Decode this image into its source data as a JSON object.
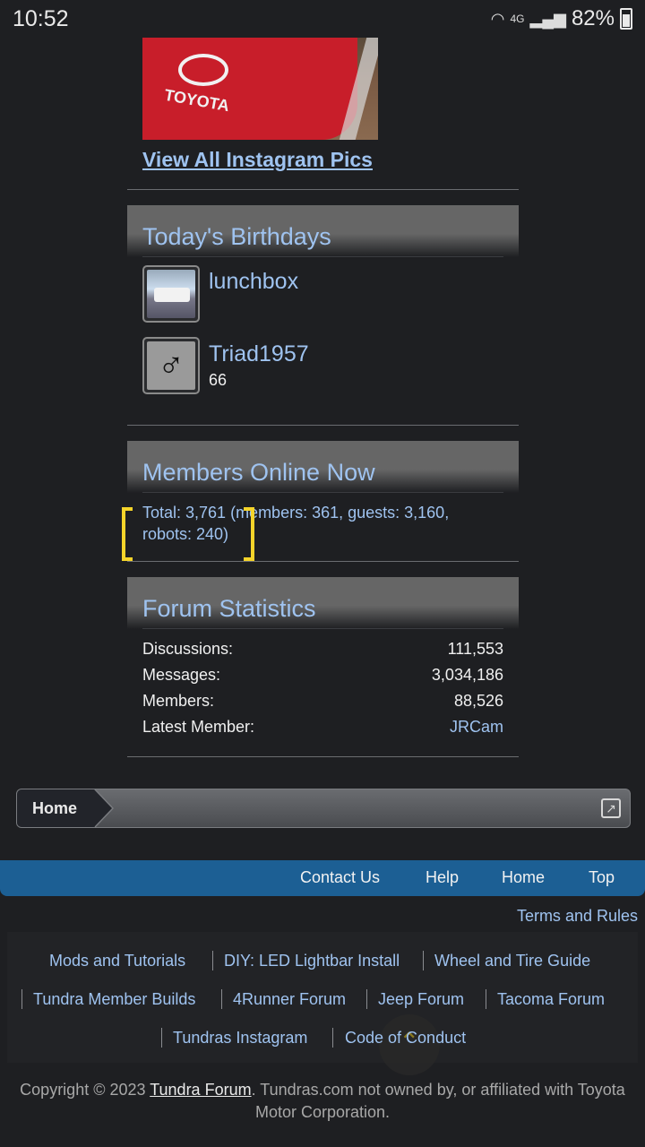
{
  "status_bar": {
    "time": "10:52",
    "network": "4G",
    "battery": "82%"
  },
  "instagram": {
    "image_brand": "TOYOTA",
    "link": "View All Instagram Pics"
  },
  "birthdays": {
    "title": "Today's Birthdays",
    "users": [
      {
        "name": "lunchbox",
        "age": ""
      },
      {
        "name": "Triad1957",
        "age": "66"
      }
    ]
  },
  "members_online": {
    "title": "Members Online Now",
    "text": "Total: 3,761 (members: 361, guests: 3,160, robots: 240)"
  },
  "forum_stats": {
    "title": "Forum Statistics",
    "rows": [
      {
        "label": "Discussions:",
        "value": "111,553"
      },
      {
        "label": "Messages:",
        "value": "3,034,186"
      },
      {
        "label": "Members:",
        "value": "88,526"
      },
      {
        "label": "Latest Member:",
        "value": "JRCam"
      }
    ]
  },
  "breadcrumb": {
    "home": "Home"
  },
  "footer_nav": {
    "contact": "Contact Us",
    "help": "Help",
    "home": "Home",
    "top": "Top",
    "terms": "Terms and Rules"
  },
  "footer_links": [
    "Mods and Tutorials",
    "DIY: LED Lightbar Install",
    "Wheel and Tire Guide",
    "Tundra Member Builds",
    "4Runner Forum",
    "Jeep Forum",
    "Tacoma Forum",
    "Tundras Instagram",
    "Code of Conduct"
  ],
  "copyright": {
    "prefix": "Copyright © 2023 ",
    "link": "Tundra Forum",
    "suffix": ". Tundras.com not owned by, or affiliated with Toyota Motor Corporation."
  },
  "colors": {
    "link": "#9fc3f0",
    "footer_bar": "#1c5f94",
    "highlight_bracket": "#f5d42a"
  }
}
